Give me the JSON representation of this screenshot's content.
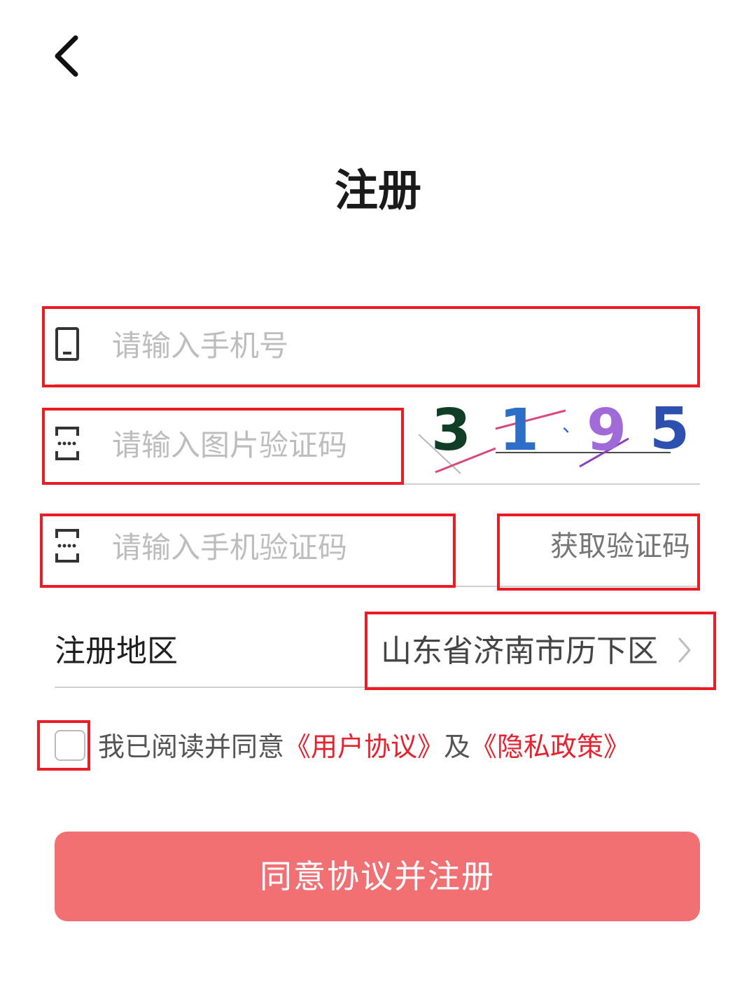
{
  "header": {
    "back_icon": "chevron-left-icon"
  },
  "title": "注册",
  "phone": {
    "icon": "phone-icon",
    "placeholder": "请输入手机号"
  },
  "captcha": {
    "icon": "code-input-icon",
    "placeholder": "请输入图片验证码",
    "image_text": "31 9 5"
  },
  "sms": {
    "icon": "code-input-icon",
    "placeholder": "请输入手机验证码",
    "send_label": "获取验证码"
  },
  "region": {
    "label": "注册地区",
    "value": "山东省济南市历下区",
    "icon": "chevron-right-icon"
  },
  "agreement": {
    "prefix": "我已阅读并同意",
    "user_agreement": "《用户协议》",
    "conjunction": "及",
    "privacy_policy": "《隐私政策》"
  },
  "submit": {
    "label": "同意协议并注册"
  },
  "colors": {
    "accent": "#f07074",
    "link": "#e4232f",
    "highlight": "#ec1c24"
  }
}
